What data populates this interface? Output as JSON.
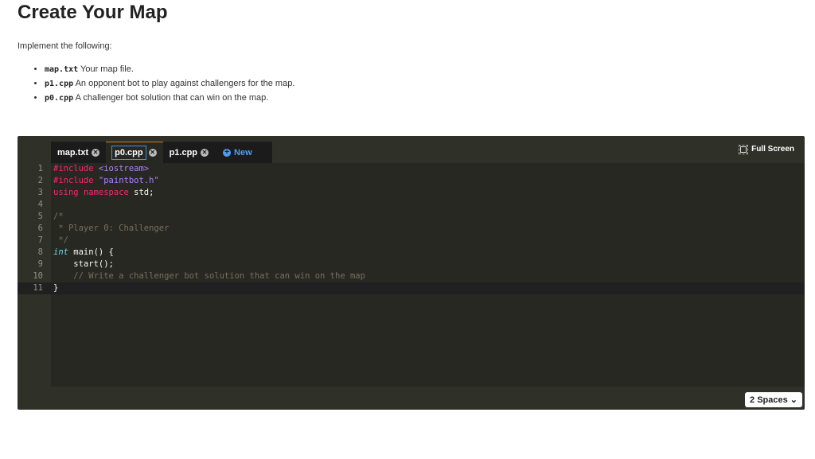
{
  "title": "Create Your Map",
  "intro": "Implement the following:",
  "items": [
    {
      "file": "map.txt",
      "desc": "Your map file."
    },
    {
      "file": "p1.cpp",
      "desc": "An opponent bot to play against challengers for the map."
    },
    {
      "file": "p0.cpp",
      "desc": "A challenger bot solution that can win on the map."
    }
  ],
  "tabs": [
    "map.txt",
    "p0.cpp",
    "p1.cpp"
  ],
  "new_label": "New",
  "fullscreen_label": "Full Screen",
  "indent_select": "2 Spaces",
  "active_line": 11,
  "lines": [
    "1",
    "2",
    "3",
    "4",
    "5",
    "6",
    "7",
    "8",
    "9",
    "10",
    "11"
  ]
}
